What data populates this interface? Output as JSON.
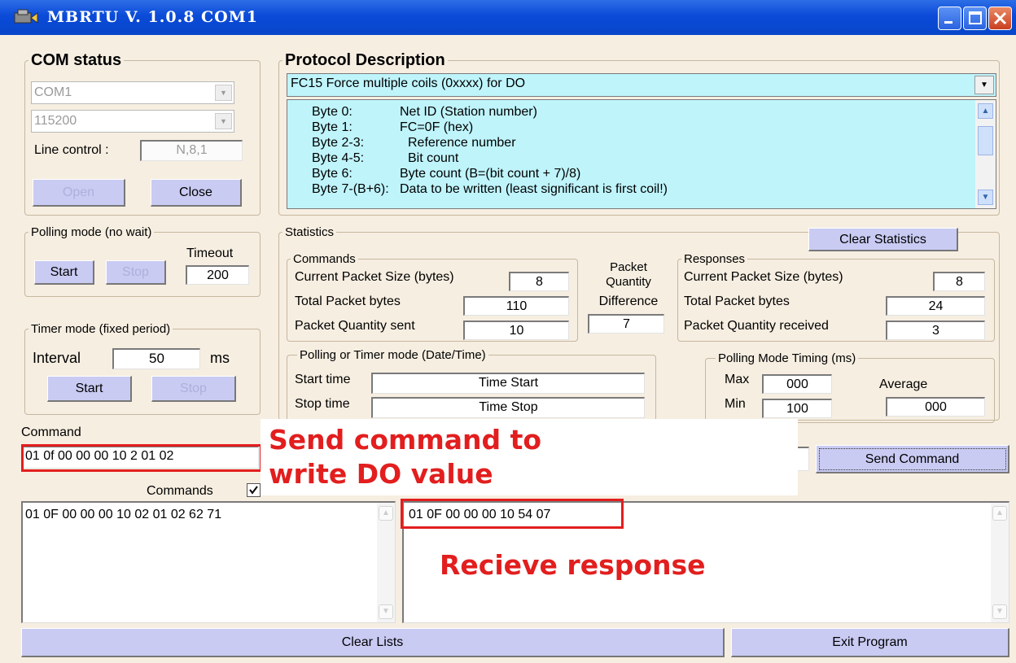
{
  "window": {
    "title": "MBRTU  V. 1.0.8  COM1"
  },
  "com_status": {
    "legend": "COM status",
    "port": "COM1",
    "baud": "115200",
    "line_control_label": "Line control :",
    "line_control_value": "N,8,1",
    "open_label": "Open",
    "close_label": "Close"
  },
  "protocol": {
    "legend": "Protocol Description",
    "selected": "FC15 Force multiple coils (0xxxx)  for DO",
    "lines": [
      {
        "byte": "Byte 0:",
        "desc": "Net ID (Station number)"
      },
      {
        "byte": "Byte 1:",
        "desc": "FC=0F (hex)"
      },
      {
        "byte": "Byte 2-3:",
        "desc": "Reference number"
      },
      {
        "byte": "Byte 4-5:",
        "desc": "Bit count"
      },
      {
        "byte": "Byte 6:",
        "desc": "Byte count (B=(bit count + 7)/8)"
      },
      {
        "byte": "Byte 7-(B+6):",
        "desc": "Data to be written (least significant is first coil!)"
      }
    ]
  },
  "polling": {
    "legend": "Polling mode (no wait)",
    "timeout_label": "Timeout",
    "timeout_value": "200",
    "start_label": "Start",
    "stop_label": "Stop"
  },
  "timer": {
    "legend": "Timer mode (fixed period)",
    "interval_label": "Interval",
    "interval_value": "50",
    "unit": "ms",
    "start_label": "Start",
    "stop_label": "Stop"
  },
  "statistics": {
    "legend": "Statistics",
    "clear_label": "Clear Statistics",
    "commands": {
      "legend": "Commands",
      "current_size_label": "Current Packet Size (bytes)",
      "current_size": "8",
      "total_bytes_label": "Total Packet bytes",
      "total_bytes": "110",
      "qty_label": "Packet Quantity sent",
      "qty": "10"
    },
    "difference": {
      "line1": "Packet",
      "line2": "Quantity",
      "line3": "Difference",
      "value": "7"
    },
    "responses": {
      "legend": "Responses",
      "current_size_label": "Current Packet Size (bytes)",
      "current_size": "8",
      "total_bytes_label": "Total Packet bytes",
      "total_bytes": "24",
      "qty_label": "Packet Quantity received",
      "qty": "3"
    },
    "datetime": {
      "legend": "Polling  or Timer mode  (Date/Time)",
      "start_label": "Start time",
      "start_value": "Time Start",
      "stop_label": "Stop time",
      "stop_value": "Time Stop"
    },
    "timing": {
      "legend": "Polling Mode Timing (ms)",
      "max_label": "Max",
      "max_value": "000",
      "min_label": "Min",
      "min_value": "100",
      "avg_label": "Average",
      "avg_value": "000"
    }
  },
  "command": {
    "label": "Command",
    "value": "01 0f 00 00 00 10 2 01 02",
    "send_label": "Send Command"
  },
  "lists": {
    "commands_label": "Commands",
    "commands_checked": true,
    "commands_items": [
      "01 0F 00 00 00 10 02 01 02 62 71"
    ],
    "responses_items": [
      "01 0F 00 00 00 10 54 07"
    ]
  },
  "annotations": {
    "send_line1": "Send command to",
    "send_line2": "write DO value",
    "receive": "Recieve response",
    "color": "#e21e1e"
  },
  "footer": {
    "clear_lists_label": "Clear Lists",
    "exit_label": "Exit Program"
  }
}
